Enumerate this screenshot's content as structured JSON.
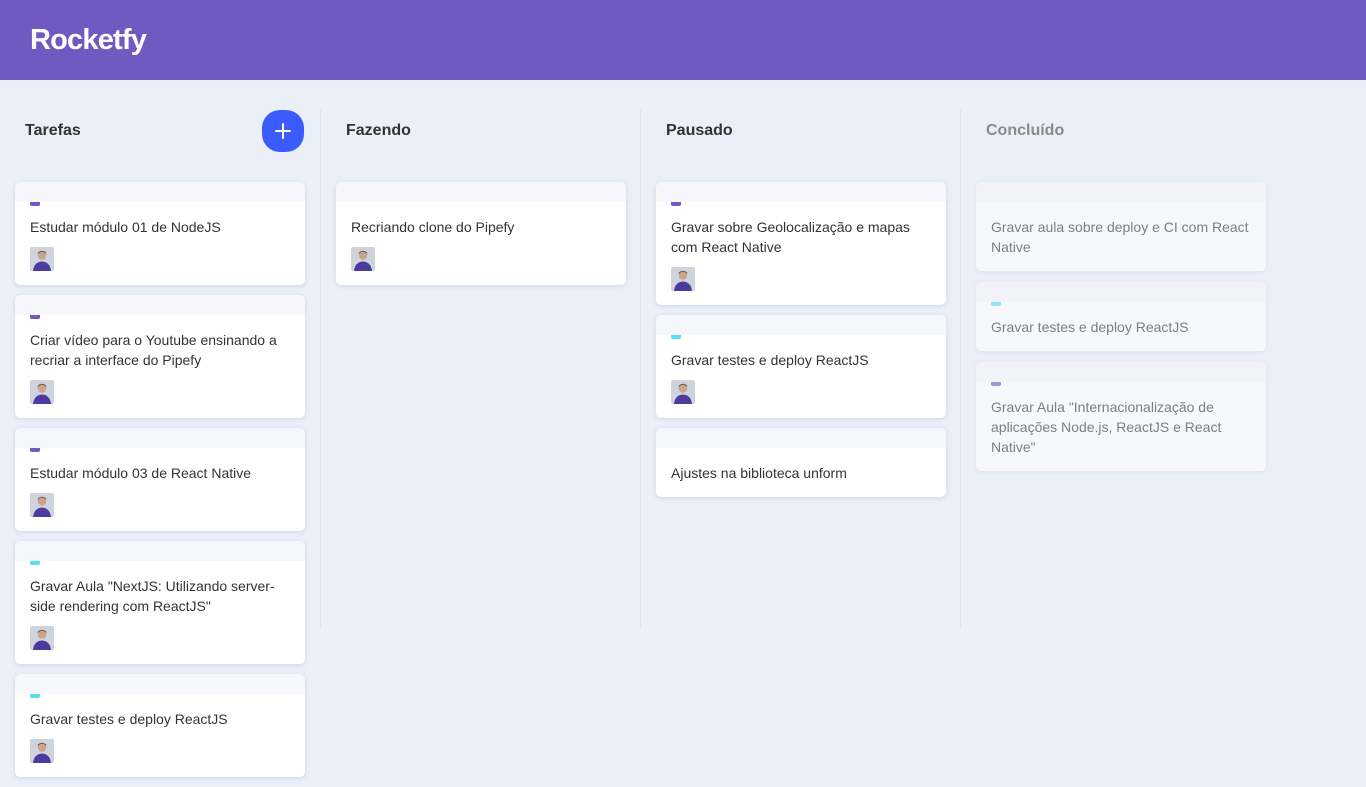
{
  "app": {
    "title": "Rocketfy"
  },
  "lists": [
    {
      "title": "Tarefas",
      "creatable": true,
      "done": false,
      "cards": [
        {
          "content": "Estudar módulo 01 de NodeJS",
          "label_color": "#7159c1",
          "has_avatar": true
        },
        {
          "content": "Criar vídeo para o Youtube ensinando a recriar a interface do Pipefy",
          "label_color": "#7159c1",
          "has_avatar": true
        },
        {
          "content": "Estudar módulo 03 de React Native",
          "label_color": "#7159c1",
          "has_avatar": true
        },
        {
          "content": "Gravar Aula \"NextJS: Utilizando server-side rendering com ReactJS\"",
          "label_color": "#54e1f7",
          "has_avatar": true
        },
        {
          "content": "Gravar testes e deploy ReactJS",
          "label_color": "#54e1f7",
          "has_avatar": true
        }
      ]
    },
    {
      "title": "Fazendo",
      "creatable": false,
      "done": false,
      "cards": [
        {
          "content": "Recriando clone do Pipefy",
          "label_color": "",
          "has_avatar": true
        }
      ]
    },
    {
      "title": "Pausado",
      "creatable": false,
      "done": false,
      "cards": [
        {
          "content": "Gravar sobre Geolocalização e mapas com React Native",
          "label_color": "#7159c1",
          "has_avatar": true
        },
        {
          "content": "Gravar testes e deploy ReactJS",
          "label_color": "#54e1f7",
          "has_avatar": true
        },
        {
          "content": "Ajustes na biblioteca unform",
          "label_color": "",
          "has_avatar": false
        }
      ]
    },
    {
      "title": "Concluído",
      "creatable": false,
      "done": true,
      "cards": [
        {
          "content": "Gravar aula sobre deploy e CI com React Native",
          "label_color": "",
          "has_avatar": false
        },
        {
          "content": "Gravar testes e deploy ReactJS",
          "label_color": "#54e1f7",
          "has_avatar": false
        },
        {
          "content": "Gravar Aula \"Internacionalização de aplicações Node.js, ReactJS e React Native\"",
          "label_color": "#7159c1",
          "has_avatar": false
        }
      ]
    }
  ]
}
